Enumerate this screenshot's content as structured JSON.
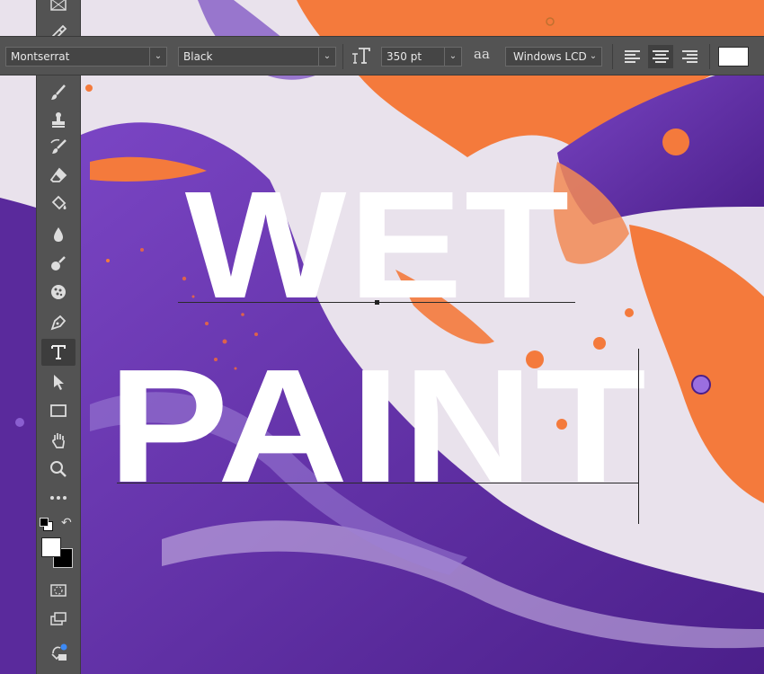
{
  "options_bar": {
    "font_family": "Montserrat",
    "font_style": "Black",
    "font_size": "350 pt",
    "anti_alias_glyph": "aa",
    "anti_alias_method": "Windows LCD",
    "text_color": "#ffffff"
  },
  "canvas": {
    "line1": "WET",
    "line2": "PAINT"
  },
  "colors": {
    "orange": "#f47a3c",
    "purple": "#6a33b0",
    "deep_purple": "#4b1f8a",
    "lavender": "#e6dde8",
    "panel": "#535353"
  },
  "tools": [
    "frame-tool-icon",
    "eyedropper-icon",
    "brush-icon",
    "clone-stamp-icon",
    "history-brush-icon",
    "eraser-icon",
    "paint-bucket-icon",
    "blur-icon",
    "dodge-icon",
    "sponge-icon",
    "pen-icon",
    "type-icon",
    "path-selection-icon",
    "rectangle-icon",
    "hand-icon",
    "zoom-icon",
    "more-icon"
  ]
}
